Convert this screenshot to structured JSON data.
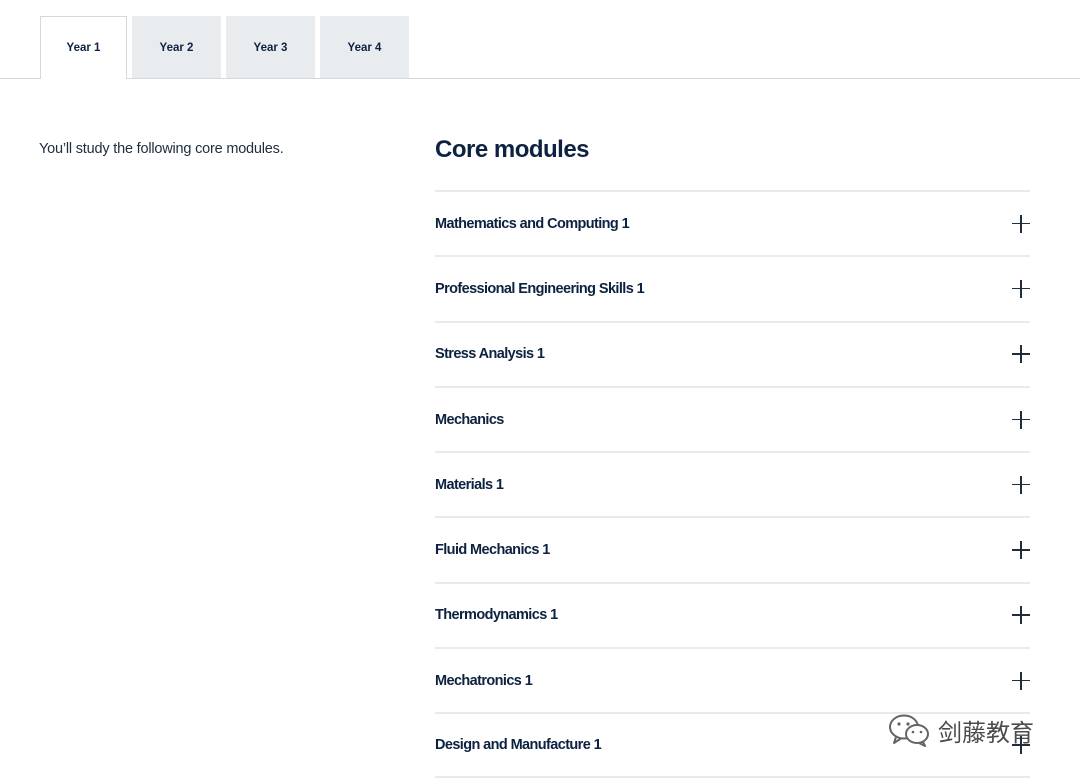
{
  "tabs": [
    {
      "label": "Year 1",
      "active": true
    },
    {
      "label": "Year 2",
      "active": false
    },
    {
      "label": "Year 3",
      "active": false
    },
    {
      "label": "Year 4",
      "active": false
    }
  ],
  "intro_text": "You’ll study the following core modules.",
  "section_title": "Core modules",
  "modules": [
    {
      "label": "Mathematics and Computing 1",
      "icon": "plus-icon"
    },
    {
      "label": "Professional Engineering Skills 1",
      "icon": "plus-icon"
    },
    {
      "label": "Stress Analysis 1",
      "icon": "plus-icon"
    },
    {
      "label": "Mechanics",
      "icon": "plus-icon"
    },
    {
      "label": "Materials 1",
      "icon": "plus-icon"
    },
    {
      "label": "Fluid Mechanics 1",
      "icon": "plus-icon"
    },
    {
      "label": "Thermodynamics 1",
      "icon": "plus-icon"
    },
    {
      "label": "Mechatronics 1",
      "icon": "plus-icon"
    },
    {
      "label": "Design and Manufacture 1",
      "icon": "plus-icon"
    }
  ],
  "watermark": {
    "text": "剑藤教育",
    "icon": "wechat-icon"
  },
  "colors": {
    "text": "#0d2240",
    "tab_inactive": "#e9ecee",
    "divider": "#e8eaec"
  }
}
